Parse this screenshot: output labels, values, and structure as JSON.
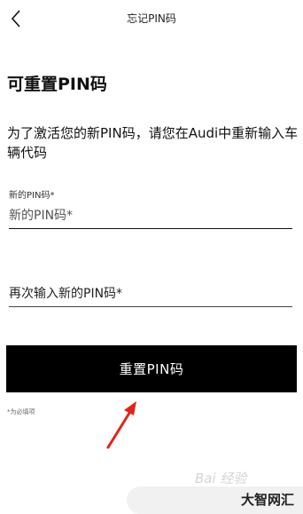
{
  "header": {
    "back_icon": "chevron-left-icon",
    "title": "忘记PIN码"
  },
  "content": {
    "heading": "可重置PIN码",
    "description": "为了激活您的新PIN码，请您在Audi中重新输入车辆代码"
  },
  "form": {
    "new_pin": {
      "label": "新的PIN码*",
      "placeholder": "新的PIN码*"
    },
    "confirm_pin": {
      "placeholder": "再次输入新的PIN码*"
    },
    "submit_label": "重置PIN码",
    "required_note": "*为必填项"
  },
  "overlay": {
    "arrow_color": "#e0241b",
    "watermark_faint": "Bai 经验",
    "watermark_brand": "大智网汇"
  },
  "colors": {
    "button_bg": "#000000",
    "button_text": "#ffffff"
  }
}
